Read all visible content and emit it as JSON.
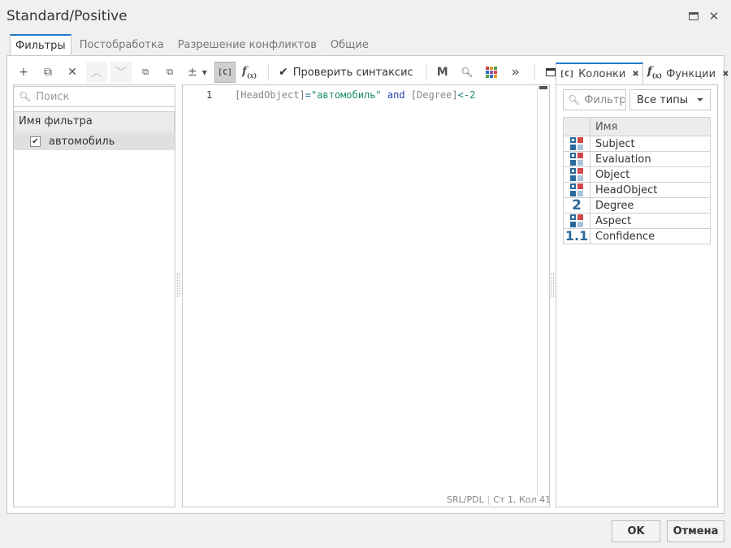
{
  "window": {
    "title": "Standard/Positive",
    "maximize_icon": "maximize-icon",
    "close_icon": "close-icon"
  },
  "tabs": [
    {
      "label": "Фильтры",
      "active": true
    },
    {
      "label": "Постобработка",
      "active": false
    },
    {
      "label": "Разрешение конфликтов",
      "active": false
    },
    {
      "label": "Общие",
      "active": false
    }
  ],
  "toolbar": {
    "icons": [
      "add-icon",
      "copy-icon",
      "delete-icon",
      "move-up-icon",
      "move-down-icon",
      "collapse-icon",
      "expand-icon",
      "plus-minus-icon",
      "dropdown-caret-icon",
      "columns-toggle-icon",
      "functions-toggle-icon",
      "check-icon",
      "m-icon",
      "zoom-icon",
      "color-grid-icon",
      "more-icon",
      "panel-icon"
    ],
    "check_syntax_label": "Проверить синтаксис",
    "m_label": "M",
    "c_label": "[C]",
    "more_label": "»"
  },
  "filters": {
    "search_placeholder": "Поиск",
    "column_header": "Имя фильтра",
    "items": [
      {
        "name": "автомобиль",
        "checked": true
      }
    ]
  },
  "editor": {
    "line_number": "1",
    "code_tokens": [
      {
        "text": "[",
        "cls": "tok-br"
      },
      {
        "text": "HeadObject",
        "cls": "tok-id"
      },
      {
        "text": "]",
        "cls": "tok-br"
      },
      {
        "text": "=",
        "cls": "tok-op"
      },
      {
        "text": "\"автомобиль\"",
        "cls": "tok-str"
      },
      {
        "text": " and ",
        "cls": "tok-kw"
      },
      {
        "text": "[",
        "cls": "tok-br"
      },
      {
        "text": "Degree",
        "cls": "tok-id"
      },
      {
        "text": "]",
        "cls": "tok-br"
      },
      {
        "text": "<-",
        "cls": "tok-op"
      },
      {
        "text": "2",
        "cls": "tok-num"
      }
    ],
    "status_lang": "SRL/PDL",
    "status_pos": "Ст 1, Кол 41"
  },
  "right_panel": {
    "tab_columns": "Колонки",
    "tab_columns_prefix": "[C]",
    "tab_functions": "Функции",
    "filter_placeholder": "Фильтр",
    "type_select": "Все типы",
    "column_header": "Имя",
    "columns": [
      {
        "name": "Subject",
        "type": "text"
      },
      {
        "name": "Evaluation",
        "type": "text"
      },
      {
        "name": "Object",
        "type": "text"
      },
      {
        "name": "HeadObject",
        "type": "text"
      },
      {
        "name": "Degree",
        "type": "int",
        "glyph": "2"
      },
      {
        "name": "Aspect",
        "type": "text"
      },
      {
        "name": "Confidence",
        "type": "float",
        "glyph": "1.1"
      }
    ]
  },
  "footer": {
    "ok_label": "OK",
    "cancel_label": "Отмена"
  },
  "colors": {
    "accent": "#1f79c9",
    "type_blue": "#2a6a9a",
    "type_red": "#d04848",
    "type_light": "#a9c4dc"
  }
}
